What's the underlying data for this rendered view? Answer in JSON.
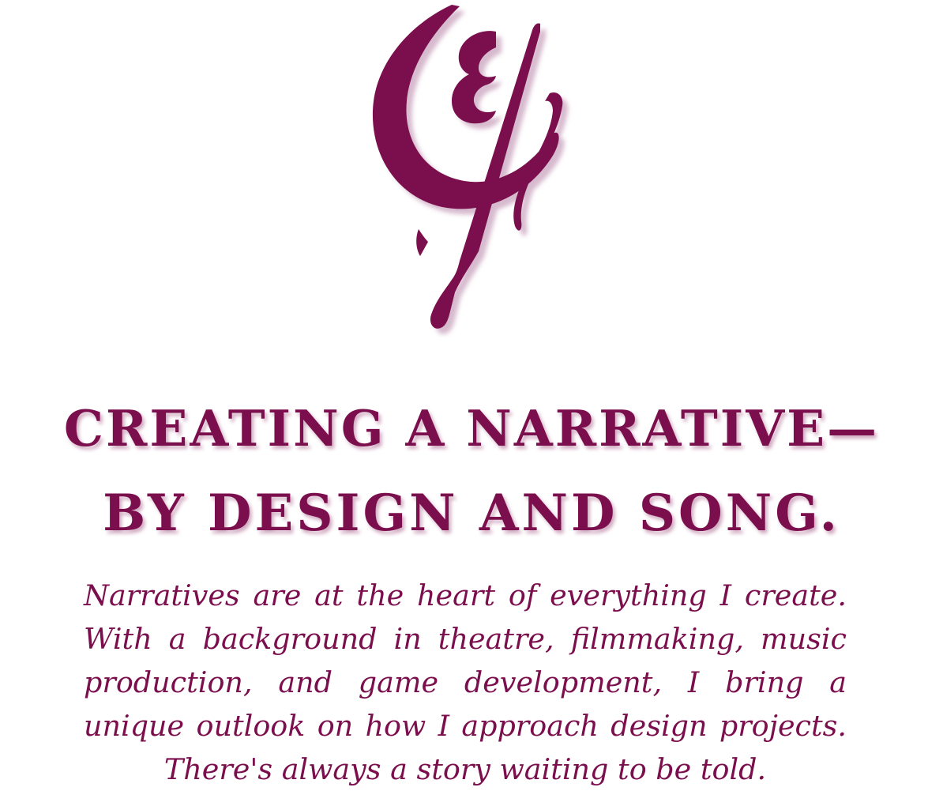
{
  "logo": {
    "icon": "monogram-dancer-logo",
    "color": "#7b0f4d",
    "shadow_color": "#c9a3bd"
  },
  "headline": {
    "line1": "CREATING A NARRATIVE—",
    "line2": "BY DESIGN AND SONG."
  },
  "intro": {
    "text": "Narratives are at the heart of everything I create. With a background in theatre, filmmaking, music production, and game development, I bring a unique outlook on how I approach design projects. There's always a story waiting to be told."
  },
  "colors": {
    "brand": "#7b0f4d",
    "background": "#ffffff"
  }
}
